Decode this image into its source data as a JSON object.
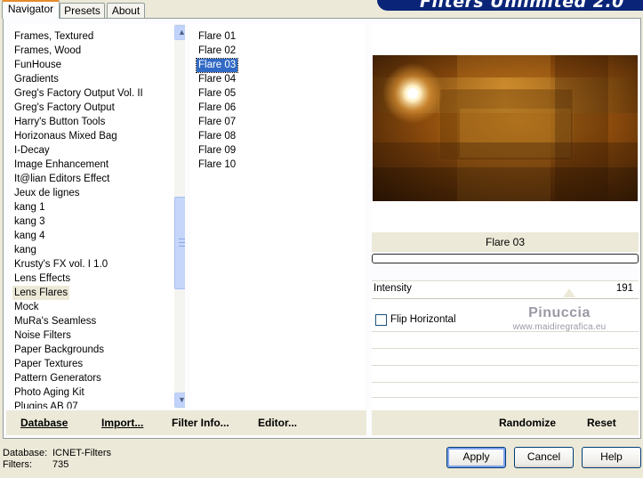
{
  "tabs": [
    {
      "label": "Navigator"
    },
    {
      "label": "Presets"
    },
    {
      "label": "About"
    }
  ],
  "brand": {
    "title": "Filters Unlimited 2.0"
  },
  "categories": [
    "Frames, Textured",
    "Frames, Wood",
    "FunHouse",
    "Gradients",
    "Greg's Factory Output Vol. II",
    "Greg's Factory Output",
    "Harry's Button Tools",
    "Horizonaus Mixed Bag",
    "I-Decay",
    "Image Enhancement",
    "It@lian Editors Effect",
    "Jeux de lignes",
    "kang 1",
    "kang 3",
    "kang 4",
    "kang",
    "Krusty's FX vol. I 1.0",
    "Lens Effects",
    "Lens Flares",
    "Mock",
    "MuRa's Seamless",
    "Noise Filters",
    "Paper Backgrounds",
    "Paper Textures",
    "Pattern Generators",
    "Photo Aging Kit",
    "Plugins AB 07"
  ],
  "selected_category": "Lens Flares",
  "filters": [
    "Flare 01",
    "Flare 02",
    "Flare 03",
    "Flare 04",
    "Flare 05",
    "Flare 06",
    "Flare 07",
    "Flare 08",
    "Flare 09",
    "Flare 10"
  ],
  "selected_filter": "Flare 03",
  "preview": {
    "filter_name": "Flare 03"
  },
  "params": {
    "intensity_label": "Intensity",
    "intensity_value": "191",
    "flip_label": "Flip Horizontal",
    "flip_checked": false
  },
  "watermark": {
    "name": "Pinuccia",
    "url": "www.maidiregrafica.eu"
  },
  "left_actions": {
    "database": "Database",
    "import": "Import...",
    "filter_info": "Filter Info...",
    "editor": "Editor..."
  },
  "right_actions": {
    "randomize": "Randomize",
    "reset": "Reset"
  },
  "status": {
    "database_label": "Database:",
    "database_value": "ICNET-Filters",
    "filters_label": "Filters:",
    "filters_value": "735"
  },
  "buttons": {
    "apply": "Apply",
    "cancel": "Cancel",
    "help": "Help"
  },
  "colors": {
    "selection": "#316ac5",
    "panel": "#ece9d8",
    "brand": "#0a2478"
  }
}
